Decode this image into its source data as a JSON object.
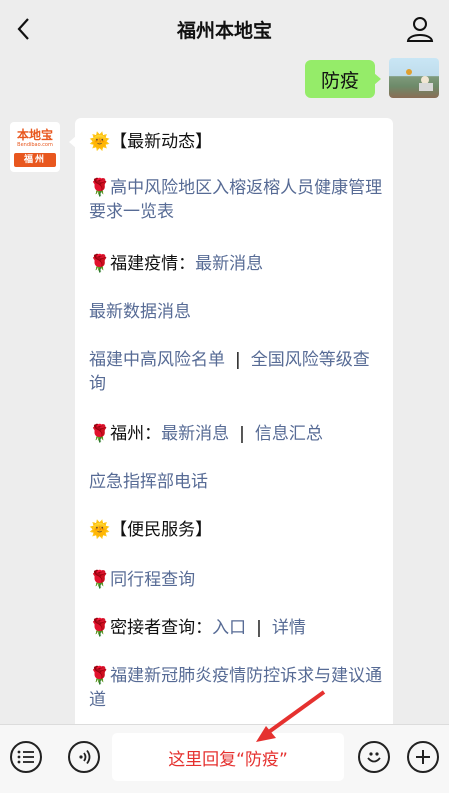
{
  "header": {
    "title": "福州本地宝"
  },
  "outgoing": {
    "text": "防疫"
  },
  "avatar_in": {
    "logo": "本地宝",
    "sub": "Bendibao.com",
    "city": "福州"
  },
  "message": {
    "section1_title": "【最新动态】",
    "item1": "高中风险地区入榕返榕人员健康管理要求一览表",
    "item2_label": "福建疫情：",
    "item2_link": "最新消息",
    "item3": "最新数据消息",
    "item4_a": "福建中高风险名单",
    "item4_sep": "|",
    "item4_b": "全国风险等级查询",
    "item5_label": "福州：",
    "item5_a": "最新消息",
    "item5_sep": "|",
    "item5_b": "信息汇总",
    "item6": "应急指挥部电话",
    "section2_title": "【便民服务】",
    "item7": "同行程查询",
    "item8_label": "密接者查询：",
    "item8_a": "入口",
    "item8_sep": "|",
    "item8_b": "详情",
    "item9": "福建新冠肺炎疫情防控诉求与建议通道"
  },
  "input": {
    "text": "这里回复“防疫”"
  },
  "icons": {
    "back": "chevron-left-icon",
    "profile": "person-icon",
    "sun": "sun-emoji-icon",
    "flower": "rose-emoji-icon",
    "menu": "menu-list-icon",
    "voice": "voice-icon",
    "emoji": "smiley-icon",
    "plus": "plus-icon"
  },
  "colors": {
    "link": "#576b95",
    "bubble_out": "#95ec69",
    "hint": "#e5312f"
  }
}
